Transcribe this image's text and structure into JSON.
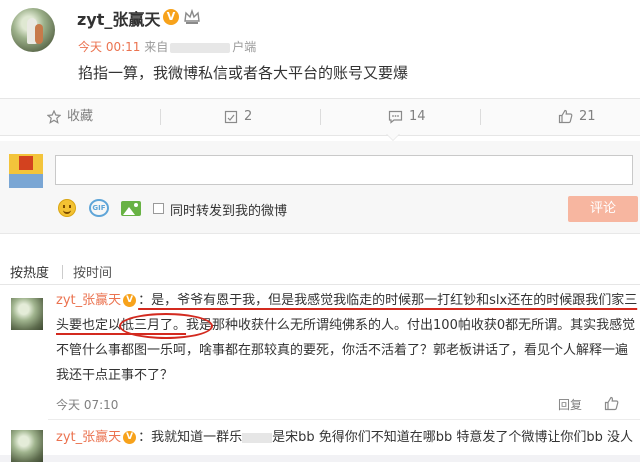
{
  "post": {
    "user_name": "zyt_张赢天",
    "verified_badge": "V",
    "time": "今天 00:11",
    "source_prefix": "来自",
    "source_suffix": "户端",
    "text": "掐指一算，我微博私信或者各大平台的账号又要爆"
  },
  "actions": {
    "favorite_label": "收藏",
    "repost_count": "2",
    "comment_count": "14",
    "like_count": "21"
  },
  "composer": {
    "input_value": "",
    "repost_label": "同时转发到我的微博",
    "submit_label": "评论"
  },
  "sort": {
    "hot_label": "按热度",
    "time_label": "按时间"
  },
  "comments": [
    {
      "user_name": "zyt_张赢天",
      "badge": "V",
      "text_a": "：是，爷爷有恩于我，但是我感觉我临走的时候那一打红钞和slx还在的时候跟我们家三头要也",
      "text_b": "定以抵三月了。",
      "text_c": "我是那种收获什么无所谓纯佛系的人。付出100帕收获0都无所谓。其实我感觉不管什么事都图一乐呵，啥事都在那较真的要死，你活不活着了？郭老板讲话了，看见个人解释一遍我还干点正事不了？",
      "time": "今天 07:10",
      "reply_label": "回复"
    },
    {
      "user_name": "zyt_张赢天",
      "badge": "V",
      "text": "：我就知道一群乐",
      "text_tail": "是宋bb 免得你们不知道在哪bb 特意发了个微博让你们bb 没人"
    }
  ],
  "colors": {
    "accent": "#eb7350",
    "badge": "#f7a21b",
    "annotation_red": "#d32a1f",
    "submit_disabled": "#f7b6a0"
  },
  "icons": [
    "crown-icon",
    "favorite-icon",
    "repost-icon",
    "comment-icon",
    "like-icon",
    "emoji-icon",
    "gif-icon",
    "picture-icon"
  ]
}
